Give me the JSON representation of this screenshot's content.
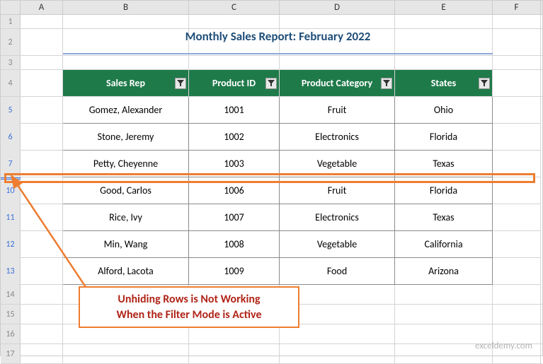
{
  "columns": [
    "A",
    "B",
    "C",
    "D",
    "E",
    "F"
  ],
  "rows_visible": [
    "1",
    "2",
    "3",
    "4",
    "5",
    "6",
    "7",
    "10",
    "11",
    "12",
    "13",
    "14",
    "15",
    "16",
    "17"
  ],
  "filtered_rows": [
    "5",
    "6",
    "7",
    "10",
    "11",
    "12",
    "13"
  ],
  "title": "Monthly Sales Report: February 2022",
  "headers": {
    "sales_rep": "Sales Rep",
    "product_id": "Product ID",
    "product_category": "Product Category",
    "states": "States"
  },
  "data": [
    {
      "rep": "Gomez, Alexander",
      "pid": "1001",
      "cat": "Fruit",
      "state": "Ohio"
    },
    {
      "rep": "Stone, Jeremy",
      "pid": "1002",
      "cat": "Electronics",
      "state": "Florida"
    },
    {
      "rep": "Petty, Cheyenne",
      "pid": "1003",
      "cat": "Vegetable",
      "state": "Texas"
    },
    {
      "rep": "Good, Carlos",
      "pid": "1006",
      "cat": "Fruit",
      "state": "Florida"
    },
    {
      "rep": "Rice, Ivy",
      "pid": "1007",
      "cat": "Electronics",
      "state": "Texas"
    },
    {
      "rep": "Min, Wang",
      "pid": "1008",
      "cat": "Vegetable",
      "state": "California"
    },
    {
      "rep": "Alford, Lacota",
      "pid": "1009",
      "cat": "Food",
      "state": "Arizona"
    }
  ],
  "callout_line1": "Unhiding Rows is Not Working",
  "callout_line2": "When the Filter Mode is Active",
  "watermark": "exceldemy.com",
  "colors": {
    "accent_orange": "#ed7d31",
    "header_green": "#1f7a4a",
    "title_blue": "#1f4e79",
    "callout_text": "#b02418"
  },
  "chart_data": {
    "type": "table",
    "title": "Monthly Sales Report: February 2022",
    "columns": [
      "Sales Rep",
      "Product ID",
      "Product Category",
      "States"
    ],
    "rows": [
      [
        "Gomez, Alexander",
        "1001",
        "Fruit",
        "Ohio"
      ],
      [
        "Stone, Jeremy",
        "1002",
        "Electronics",
        "Florida"
      ],
      [
        "Petty, Cheyenne",
        "1003",
        "Vegetable",
        "Texas"
      ],
      [
        "Good, Carlos",
        "1006",
        "Fruit",
        "Florida"
      ],
      [
        "Rice, Ivy",
        "1007",
        "Electronics",
        "Texas"
      ],
      [
        "Min, Wang",
        "1008",
        "Vegetable",
        "California"
      ],
      [
        "Alford, Lacota",
        "1009",
        "Food",
        "Arizona"
      ]
    ],
    "hidden_rows_note": "Rows 8-9 are hidden (filtered out)"
  }
}
